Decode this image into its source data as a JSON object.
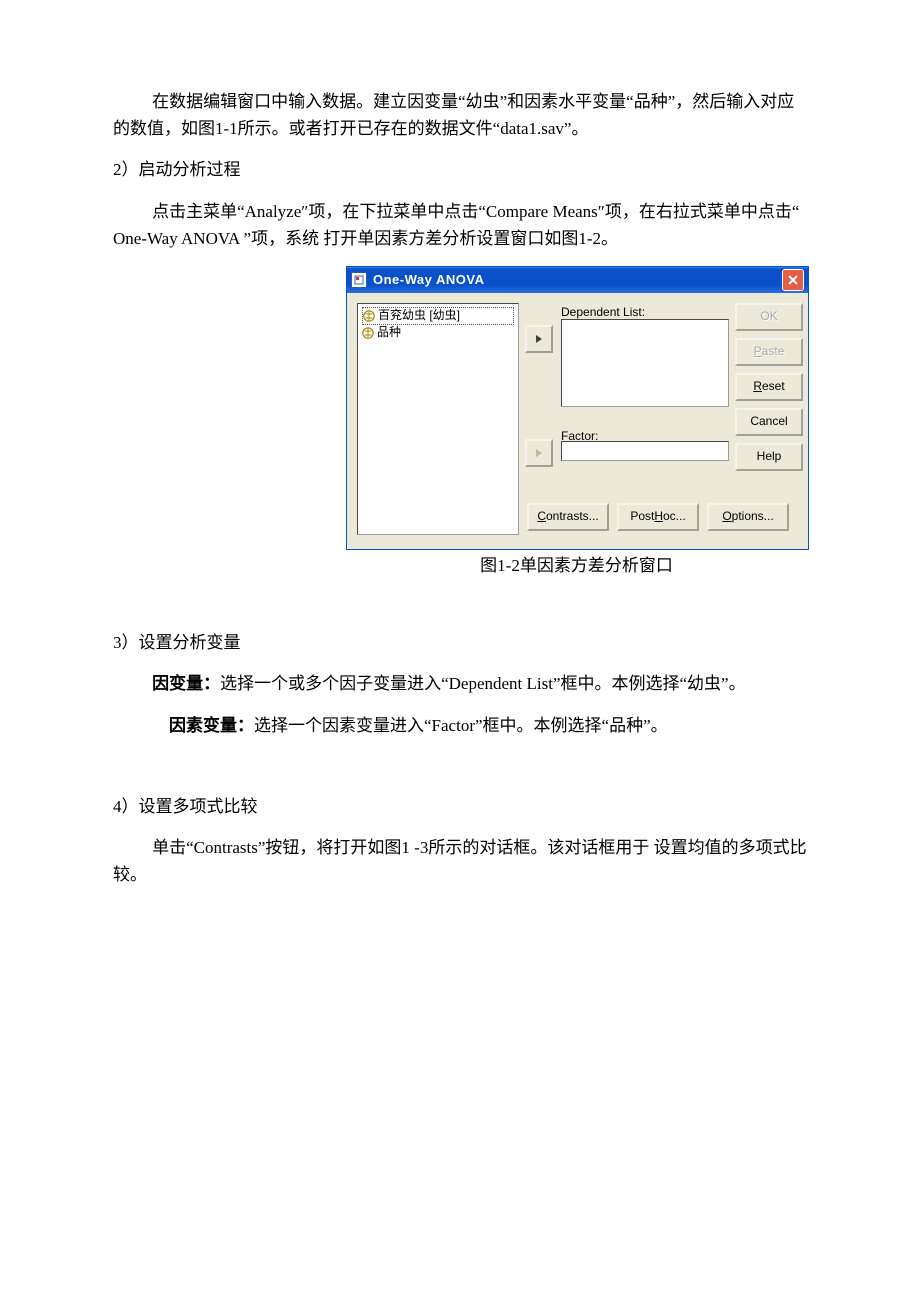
{
  "para1": "在数据编辑窗口中输入数据。建立因变量“幼虫”和因素水平变量“品种”，然后输入对应的数值，如图1-1所示。或者打开已存在的数据文件“data1.sav”。",
  "h2": "2）启动分析过程",
  "para2": "点击主菜单“Analyze″项，在下拉菜单中点击“Compare Means″项，在右拉式菜单中点击“ One-Way ANOVA ”项，系统 打开单因素方差分析设置窗口如图1-2。",
  "dialog": {
    "title": "One-Way ANOVA",
    "vars": [
      "百兖幼虫 [幼虫]",
      "品种"
    ],
    "dep_label": "Dependent List:",
    "factor_label": "Factor:",
    "ok": "OK",
    "paste": "Paste",
    "reset": "Reset",
    "cancel": "Cancel",
    "help": "Help",
    "contrasts": "Contrasts...",
    "posthoc": "Post Hoc...",
    "options": "Options..."
  },
  "caption": "图1-2单因素方差分析窗口",
  "h3": "3）设置分析变量",
  "p3a_b": "因变量：",
  "p3a": "选择一个或多个因子变量进入“Dependent List”框中。本例选择“幼虫”。",
  "p3b_b": "因素变量：",
  "p3b": "选择一个因素变量进入“Factor”框中。本例选择“品种”。",
  "h4": "4）设置多项式比较",
  "para4": "单击“Contrasts”按钮，将打开如图1 -3所示的对话框。该对话框用于 设置均值的多项式比较。"
}
